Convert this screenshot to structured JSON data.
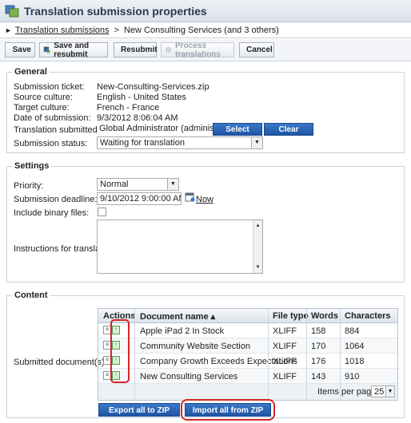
{
  "header": {
    "title": "Translation submission properties"
  },
  "breadcrumb": {
    "link": "Translation submissions",
    "current": "New Consulting Services (and 3 others)"
  },
  "toolbar": {
    "save": "Save",
    "save_resubmit": "Save and resubmit",
    "resubmit": "Resubmit",
    "process": "Process translations",
    "cancel": "Cancel"
  },
  "general": {
    "legend": "General",
    "ticket_label": "Submission ticket:",
    "ticket_value": "New-Consulting-Services.zip",
    "source_label": "Source culture:",
    "source_value": "English - United States",
    "target_label": "Target culture:",
    "target_value": "French - France",
    "date_label": "Date of submission:",
    "date_value": "9/3/2012 8:06:04 AM",
    "submitted_by_label": "Translation submitted by:",
    "submitted_by_value": "Global Administrator (administrato",
    "select_button": "Select",
    "clear_button": "Clear",
    "status_label": "Submission status:",
    "status_value": "Waiting for translation"
  },
  "settings": {
    "legend": "Settings",
    "priority_label": "Priority:",
    "priority_value": "Normal",
    "deadline_label": "Submission deadline:",
    "deadline_value": "9/10/2012 9:00:00 AM",
    "now_link": "Now",
    "binary_label": "Include binary files:",
    "binary_checked": false,
    "instructions_label": "Instructions for translators:",
    "instructions_value": ""
  },
  "content": {
    "legend": "Content",
    "submitted_label": "Submitted document(s):",
    "columns": {
      "actions": "Actions",
      "document": "Document name ▴",
      "filetype": "File type",
      "words": "Words",
      "characters": "Characters"
    },
    "rows": [
      {
        "name": "Apple iPad 2 In Stock",
        "type": "XLIFF",
        "words": "158",
        "chars": "884"
      },
      {
        "name": "Community Website Section",
        "type": "XLIFF",
        "words": "170",
        "chars": "1064"
      },
      {
        "name": "Company Growth Exceeds Expectations",
        "type": "XLIFF",
        "words": "176",
        "chars": "1018"
      },
      {
        "name": "New Consulting Services",
        "type": "XLIFF",
        "words": "143",
        "chars": "910"
      }
    ],
    "items_per_page_label": "Items per page:",
    "items_per_page_value": "25",
    "export_button": "Export all to ZIP",
    "import_button": "Import all from ZIP"
  },
  "colors": {
    "accent": "#1f55a3",
    "highlight": "#d32626"
  }
}
